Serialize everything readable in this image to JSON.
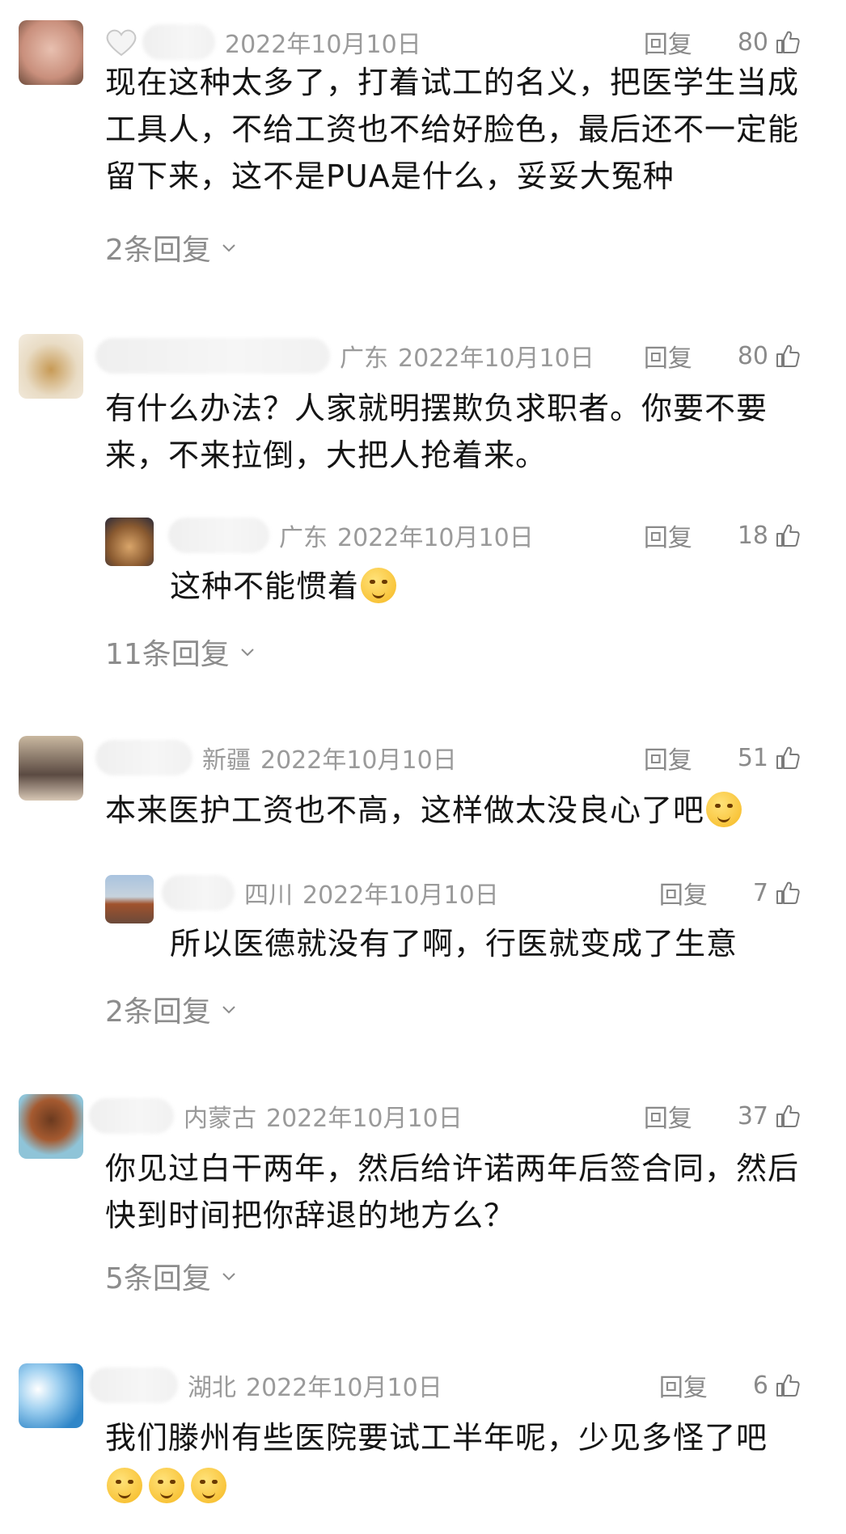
{
  "comments": [
    {
      "location": "",
      "date": "2022年10月10日",
      "reply_label": "回复",
      "likes": "80",
      "text": "现在这种太多了，打着试工的名义，把医学生当成工具人，不给工资也不给好脸色，最后还不一定能留下来，这不是PUA是什么，妥妥大冤种",
      "more": "2条回复"
    },
    {
      "location": "广东",
      "date": "2022年10月10日",
      "reply_label": "回复",
      "likes": "80",
      "text": "有什么办法？人家就明摆欺负求职者。你要不要来，不来拉倒，大把人抢着来。",
      "sub": {
        "location": "广东",
        "date": "2022年10月10日",
        "reply_label": "回复",
        "likes": "18",
        "text": "这种不能惯着"
      },
      "more": "11条回复"
    },
    {
      "location": "新疆",
      "date": "2022年10月10日",
      "reply_label": "回复",
      "likes": "51",
      "text": "本来医护工资也不高，这样做太没良心了吧",
      "sub": {
        "location": "四川",
        "date": "2022年10月10日",
        "reply_label": "回复",
        "likes": "7",
        "text": "所以医德就没有了啊，行医就变成了生意"
      },
      "more": "2条回复"
    },
    {
      "location": "内蒙古",
      "date": "2022年10月10日",
      "reply_label": "回复",
      "likes": "37",
      "text": "你见过白干两年，然后给许诺两年后签合同，然后快到时间把你辞退的地方么？",
      "more": "5条回复"
    },
    {
      "location": "湖北",
      "date": "2022年10月10日",
      "reply_label": "回复",
      "likes": "6",
      "text": "我们滕州有些医院要试工半年呢，少见多怪了吧"
    }
  ],
  "icons": {
    "thumb": "thumbs-up-icon",
    "chevron": "chevron-down-icon",
    "heart": "heart-icon"
  },
  "colors": {
    "meta": "#9a9a9a",
    "text": "#141414",
    "more": "#8c8c8c"
  }
}
